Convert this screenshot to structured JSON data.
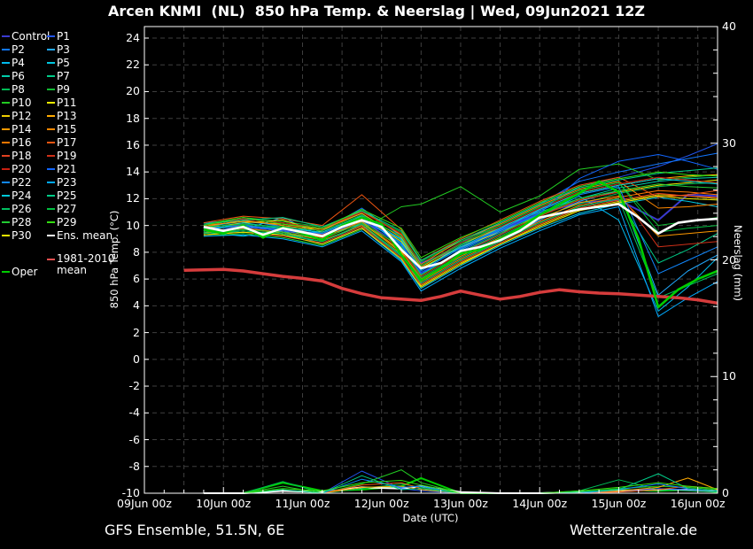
{
  "title": "Arcen KNMI  (NL)  850 hPa Temp. & Neerslag | Wed, 09Jun2021 12Z",
  "footer": {
    "left": "GFS Ensemble, 51.5N, 6E",
    "right": "Wetterzentrale.de"
  },
  "axes": {
    "x_label": "Date (UTC)",
    "y_left_label": "850 hPa Temp. (°C)",
    "y_right_label": "Neerslag (mm)",
    "x_tick_labels": [
      "09Jun 00z",
      "10Jun 00z",
      "11Jun 00z",
      "12Jun 00z",
      "13Jun 00z",
      "14Jun 00z",
      "15Jun 00z",
      "16Jun 00z"
    ],
    "y_left_tick_labels": [
      24,
      22,
      20,
      18,
      16,
      14,
      12,
      10,
      8,
      6,
      4,
      2,
      0,
      -2,
      -4,
      -6,
      -8,
      -10
    ],
    "y_right_tick_labels": [
      40,
      30,
      20,
      10,
      0
    ]
  },
  "legend": {
    "ens_mean_label": "Ens. mean",
    "ens_mean_color": "#ffffff",
    "climate_label_line1": "1981-2010",
    "climate_label_line2": "mean",
    "climate_color": "#e85050",
    "oper_label": "Oper",
    "oper_color": "#00cc00"
  },
  "chart_data": {
    "type": "line",
    "title": "Arcen KNMI (NL) 850 hPa Temp. & Neerslag | Wed, 09Jun2021 12Z",
    "x_unit": "hours since 09Jun2021 00z UTC",
    "x_range_hours": [
      0,
      174
    ],
    "x_day_tick_hours": [
      0,
      24,
      48,
      72,
      96,
      120,
      144,
      168
    ],
    "temp_axis": {
      "label": "850 hPa Temp. (°C)",
      "min": -10,
      "max": 24,
      "grid_step_c": 2,
      "top_value_c": 24.86
    },
    "precip_axis": {
      "label": "Neerslag (mm)",
      "min": 0,
      "max": 40,
      "label_step": 10
    },
    "grid": {
      "vertical_every_hours": 12,
      "horizontal_every_c": 2,
      "color": "#3f3f3f"
    },
    "mean_hours": [
      18,
      24,
      30,
      36,
      42,
      48,
      54,
      60,
      66,
      72,
      78,
      84,
      90,
      96,
      102,
      108,
      114,
      120,
      126,
      132,
      138,
      144,
      150,
      156,
      162,
      168,
      174
    ],
    "ens_mean": {
      "label": "Ens. mean",
      "color": "#ffffff",
      "temp": [
        9.9,
        9.6,
        9.9,
        9.3,
        9.8,
        9.5,
        9.2,
        9.9,
        10.4,
        9.9,
        8.2,
        6.8,
        7.2,
        8.1,
        8.4,
        8.9,
        9.6,
        10.6,
        10.9,
        11.2,
        11.4,
        11.6,
        10.6,
        9.4,
        10.2,
        10.4,
        10.5
      ]
    },
    "oper": {
      "label": "Oper",
      "color": "#00cc00",
      "temp": [
        9.7,
        9.4,
        10.0,
        9.1,
        9.9,
        9.4,
        8.9,
        10.0,
        10.6,
        10.1,
        7.8,
        5.9,
        6.8,
        7.9,
        8.2,
        9.0,
        9.8,
        10.8,
        11.6,
        12.4,
        13.3,
        12.5,
        9.0,
        3.9,
        5.2,
        6.0,
        6.6
      ]
    },
    "climate": {
      "label": "1981-2010 mean",
      "color": "#d63c3c",
      "hours": [
        12,
        18,
        24,
        30,
        36,
        42,
        48,
        54,
        60,
        66,
        72,
        78,
        84,
        90,
        96,
        102,
        108,
        114,
        120,
        126,
        132,
        138,
        144,
        150,
        156,
        162,
        168,
        174
      ],
      "temp": [
        6.65,
        6.68,
        6.72,
        6.6,
        6.4,
        6.2,
        6.05,
        5.85,
        5.3,
        4.9,
        4.6,
        4.5,
        4.4,
        4.7,
        5.1,
        4.8,
        4.5,
        4.7,
        5.0,
        5.2,
        5.05,
        4.95,
        4.9,
        4.8,
        4.7,
        4.6,
        4.45,
        4.2
      ]
    },
    "member_hours": [
      18,
      30,
      42,
      54,
      66,
      78,
      84,
      96,
      108,
      120,
      132,
      144,
      156,
      165,
      174
    ],
    "members": [
      {
        "label": "Control",
        "color": "#3a3ad0",
        "width": 2,
        "temp": [
          9.8,
          9.9,
          9.7,
          9.3,
          10.3,
          9.0,
          7.2,
          8.3,
          9.7,
          10.9,
          11.7,
          11.9,
          10.4,
          12.3,
          12.2
        ]
      },
      {
        "label": "P1",
        "color": "#2255ee",
        "width": 1,
        "temp": [
          9.6,
          10.1,
          9.5,
          9.0,
          10.8,
          8.4,
          6.5,
          8.0,
          9.3,
          11.2,
          12.9,
          13.6,
          14.4,
          15.2,
          16.1
        ]
      },
      {
        "label": "P2",
        "color": "#1177ff",
        "width": 1,
        "temp": [
          10.2,
          10.4,
          9.9,
          9.6,
          11.3,
          9.2,
          7.0,
          8.7,
          10.2,
          11.6,
          13.3,
          14.0,
          14.6,
          15.0,
          15.4
        ]
      },
      {
        "label": "P3",
        "color": "#22aaff",
        "width": 1,
        "temp": [
          9.4,
          9.7,
          10.6,
          9.2,
          10.1,
          7.8,
          5.7,
          7.4,
          8.8,
          10.4,
          11.8,
          12.6,
          4.8,
          6.6,
          7.8
        ]
      },
      {
        "label": "P4",
        "color": "#00bbee",
        "width": 1,
        "temp": [
          9.9,
          10.3,
          10.0,
          9.4,
          10.6,
          8.6,
          6.3,
          8.2,
          9.6,
          10.8,
          12.2,
          10.4,
          3.6,
          5.4,
          7.6
        ]
      },
      {
        "label": "P5",
        "color": "#00c8e0",
        "width": 1,
        "temp": [
          9.5,
          9.2,
          9.6,
          8.6,
          9.8,
          7.4,
          5.3,
          7.0,
          8.5,
          9.8,
          10.9,
          11.6,
          12.1,
          11.8,
          11.4
        ]
      },
      {
        "label": "P6",
        "color": "#00ccaa",
        "width": 1,
        "temp": [
          10.0,
          10.5,
          10.2,
          9.8,
          10.9,
          8.9,
          6.7,
          8.5,
          9.9,
          11.0,
          12.0,
          12.8,
          13.3,
          13.5,
          13.6
        ]
      },
      {
        "label": "P7",
        "color": "#00cc88",
        "width": 1,
        "temp": [
          9.3,
          9.6,
          9.3,
          8.8,
          10.0,
          7.7,
          5.9,
          7.6,
          9.0,
          10.2,
          11.4,
          12.0,
          7.2,
          8.2,
          9.4
        ]
      },
      {
        "label": "P8",
        "color": "#00bb55",
        "width": 1,
        "temp": [
          9.7,
          10.0,
          9.8,
          9.2,
          10.4,
          8.3,
          6.1,
          7.8,
          9.2,
          10.6,
          11.6,
          12.4,
          12.9,
          13.1,
          13.2
        ]
      },
      {
        "label": "P9",
        "color": "#11bb33",
        "width": 1,
        "temp": [
          10.1,
          10.6,
          10.3,
          9.9,
          11.0,
          9.5,
          7.3,
          8.8,
          10.0,
          11.4,
          12.6,
          13.2,
          10.0,
          10.3,
          10.6
        ]
      },
      {
        "label": "P10",
        "color": "#22cc22",
        "width": 1,
        "temp": [
          9.2,
          9.4,
          9.1,
          8.5,
          9.7,
          11.4,
          11.6,
          12.9,
          11.0,
          12.2,
          14.2,
          14.6,
          13.4,
          13.6,
          13.8
        ]
      },
      {
        "label": "P11",
        "color": "#eeee00",
        "width": 1,
        "temp": [
          9.8,
          10.2,
          10.4,
          9.5,
          10.7,
          8.8,
          6.8,
          8.4,
          9.5,
          10.7,
          11.9,
          12.5,
          13.0,
          13.2,
          13.4
        ]
      },
      {
        "label": "P12",
        "color": "#eecc00",
        "width": 1,
        "temp": [
          9.5,
          9.8,
          9.4,
          9.0,
          10.2,
          8.0,
          5.5,
          7.2,
          8.6,
          10.0,
          11.2,
          11.8,
          12.3,
          12.2,
          12.0
        ]
      },
      {
        "label": "P13",
        "color": "#ffaa00",
        "width": 1,
        "temp": [
          10.0,
          10.3,
          10.1,
          9.7,
          10.9,
          9.1,
          6.9,
          8.6,
          9.8,
          11.2,
          12.4,
          13.0,
          13.5,
          13.7,
          13.8
        ]
      },
      {
        "label": "P14",
        "color": "#ff9900",
        "width": 1,
        "temp": [
          9.4,
          9.9,
          9.6,
          9.1,
          10.3,
          8.1,
          6.0,
          7.7,
          9.1,
          10.5,
          11.7,
          12.2,
          9.2,
          9.4,
          9.6
        ]
      },
      {
        "label": "P15",
        "color": "#ff8800",
        "width": 1,
        "temp": [
          9.9,
          10.4,
          10.0,
          9.6,
          11.1,
          9.3,
          7.1,
          8.9,
          10.1,
          11.5,
          12.7,
          13.3,
          11.3,
          11.4,
          11.6
        ]
      },
      {
        "label": "P16",
        "color": "#ff7700",
        "width": 1,
        "temp": [
          9.6,
          9.8,
          9.5,
          8.9,
          10.0,
          7.9,
          5.8,
          7.5,
          8.9,
          10.3,
          11.5,
          12.1,
          12.6,
          12.5,
          12.3
        ]
      },
      {
        "label": "P17",
        "color": "#ee5511",
        "width": 1,
        "temp": [
          10.2,
          10.7,
          10.5,
          10.0,
          12.3,
          9.7,
          7.4,
          9.0,
          10.4,
          11.8,
          13.0,
          13.6,
          12.1,
          12.3,
          12.6
        ]
      },
      {
        "label": "P18",
        "color": "#e04020",
        "width": 1,
        "temp": [
          9.3,
          9.5,
          9.2,
          8.7,
          9.9,
          7.6,
          5.6,
          7.3,
          8.7,
          10.1,
          11.3,
          11.9,
          12.4,
          12.2,
          12.1
        ]
      },
      {
        "label": "P19",
        "color": "#d03018",
        "width": 1,
        "temp": [
          9.7,
          10.1,
          9.9,
          9.3,
          10.5,
          8.2,
          6.2,
          7.9,
          9.3,
          10.7,
          11.9,
          12.5,
          8.4,
          8.6,
          8.8
        ]
      },
      {
        "label": "P20",
        "color": "#c82010",
        "width": 1,
        "temp": [
          10.0,
          10.5,
          10.2,
          9.8,
          11.0,
          9.4,
          7.0,
          8.7,
          9.9,
          11.3,
          12.5,
          13.1,
          13.6,
          13.4,
          13.2
        ]
      },
      {
        "label": "P21",
        "color": "#1166ff",
        "width": 1,
        "temp": [
          9.5,
          9.9,
          9.6,
          9.2,
          10.4,
          8.5,
          6.4,
          8.1,
          9.5,
          10.9,
          13.5,
          14.8,
          15.3,
          14.8,
          14.2
        ]
      },
      {
        "label": "P22",
        "color": "#1188ff",
        "width": 1,
        "temp": [
          9.8,
          10.0,
          9.7,
          9.4,
          10.6,
          8.7,
          6.6,
          8.3,
          9.7,
          11.1,
          12.3,
          12.9,
          6.4,
          7.4,
          8.4
        ]
      },
      {
        "label": "P23",
        "color": "#00aaff",
        "width": 1,
        "temp": [
          9.2,
          9.3,
          9.0,
          8.4,
          9.6,
          7.3,
          5.1,
          6.8,
          8.3,
          9.6,
          10.8,
          11.4,
          3.2,
          4.6,
          5.8
        ]
      },
      {
        "label": "P24",
        "color": "#00c8d8",
        "width": 1,
        "temp": [
          9.6,
          10.2,
          9.8,
          9.5,
          10.7,
          9.0,
          6.7,
          8.4,
          9.8,
          11.2,
          12.4,
          13.0,
          13.5,
          13.3,
          13.1
        ]
      },
      {
        "label": "P25",
        "color": "#00cc88",
        "width": 1,
        "temp": [
          10.1,
          10.4,
          10.6,
          9.9,
          11.1,
          9.6,
          7.4,
          8.9,
          10.2,
          11.6,
          12.8,
          13.4,
          13.9,
          14.1,
          14.3
        ]
      },
      {
        "label": "P26",
        "color": "#00c060",
        "width": 1,
        "temp": [
          9.4,
          9.6,
          9.4,
          8.8,
          10.1,
          7.8,
          5.7,
          7.4,
          8.8,
          10.2,
          11.4,
          12.0,
          4.6,
          5.5,
          6.4
        ]
      },
      {
        "label": "P27",
        "color": "#00c040",
        "width": 1,
        "temp": [
          9.9,
          10.1,
          9.9,
          9.6,
          10.8,
          9.2,
          7.0,
          8.6,
          10.0,
          11.4,
          12.6,
          13.2,
          9.5,
          9.8,
          10.0
        ]
      },
      {
        "label": "P28",
        "color": "#22cc33",
        "width": 1,
        "temp": [
          9.5,
          9.7,
          9.5,
          9.0,
          10.2,
          8.4,
          6.3,
          8.0,
          9.4,
          10.8,
          12.0,
          12.6,
          13.1,
          12.9,
          12.8
        ]
      },
      {
        "label": "P29",
        "color": "#33dd11",
        "width": 1,
        "temp": [
          10.0,
          10.6,
          10.1,
          9.8,
          11.2,
          9.8,
          7.6,
          9.1,
          10.3,
          11.7,
          12.9,
          13.5,
          14.0,
          13.8,
          13.7
        ]
      },
      {
        "label": "P30",
        "color": "#eeee00",
        "width": 1,
        "temp": [
          9.3,
          9.5,
          9.3,
          8.6,
          9.8,
          7.5,
          5.4,
          7.1,
          8.6,
          9.9,
          11.1,
          11.7,
          12.2,
          12.0,
          11.9
        ]
      }
    ],
    "precip_members": [
      {
        "label": "Oper",
        "color": "#00cc00",
        "width": 2,
        "precip": [
          0,
          0,
          0.9,
          0.2,
          0.3,
          0.6,
          1.3,
          0,
          0,
          0,
          0.1,
          0.3,
          0.2,
          0.3,
          0.1
        ]
      },
      {
        "label": "Ens. mean",
        "color": "#ffffff",
        "width": 2,
        "precip": [
          0,
          0,
          0.2,
          0.1,
          0.5,
          0.4,
          0.6,
          0.1,
          0,
          0,
          0.1,
          0.2,
          0.3,
          0.3,
          0.2
        ]
      },
      {
        "label": "P1",
        "color": "#2255ee",
        "width": 1,
        "precip": [
          0,
          0,
          0,
          0,
          1.9,
          0.4,
          0.2,
          0,
          0,
          0,
          0,
          0.2,
          0.4,
          0.3,
          0.2
        ]
      },
      {
        "label": "P8",
        "color": "#00bb55",
        "width": 1,
        "precip": [
          0,
          0,
          1.0,
          0,
          0.4,
          0.8,
          0.5,
          0,
          0,
          0,
          0.2,
          1.15,
          0.3,
          0.2,
          0.1
        ]
      },
      {
        "label": "P10",
        "color": "#22cc22",
        "width": 1,
        "precip": [
          0,
          0,
          0.6,
          0,
          0.8,
          2.0,
          0.9,
          0,
          0,
          0,
          0.1,
          0.4,
          0.6,
          0.5,
          0.3
        ]
      },
      {
        "label": "P13",
        "color": "#ffaa00",
        "width": 1,
        "precip": [
          0,
          0,
          0,
          0,
          0.5,
          0.6,
          0.3,
          0,
          0,
          0,
          0,
          0.2,
          0.5,
          1.3,
          0.3
        ]
      },
      {
        "label": "P17",
        "color": "#ee5511",
        "width": 1,
        "precip": [
          0,
          0,
          0,
          0,
          0.7,
          0.9,
          0.4,
          0,
          0,
          0,
          0,
          0.1,
          0.3,
          0.6,
          0.4
        ]
      },
      {
        "label": "P22",
        "color": "#1188ff",
        "width": 1,
        "precip": [
          0,
          0,
          0,
          0,
          1.2,
          0.5,
          0.6,
          0,
          0,
          0,
          0,
          0.3,
          0.8,
          0.4,
          0.2
        ]
      },
      {
        "label": "P25",
        "color": "#00cc88",
        "width": 1,
        "precip": [
          0,
          0,
          0.3,
          0,
          1.5,
          0.3,
          0.4,
          0,
          0,
          0,
          0.1,
          0.3,
          1.67,
          0.4,
          0.2
        ]
      },
      {
        "label": "P29",
        "color": "#33dd11",
        "width": 1,
        "precip": [
          0,
          0,
          0.4,
          0.2,
          0.9,
          1.1,
          0.7,
          0,
          0,
          0,
          0.2,
          0.5,
          0.9,
          0.6,
          0.4
        ]
      }
    ]
  }
}
